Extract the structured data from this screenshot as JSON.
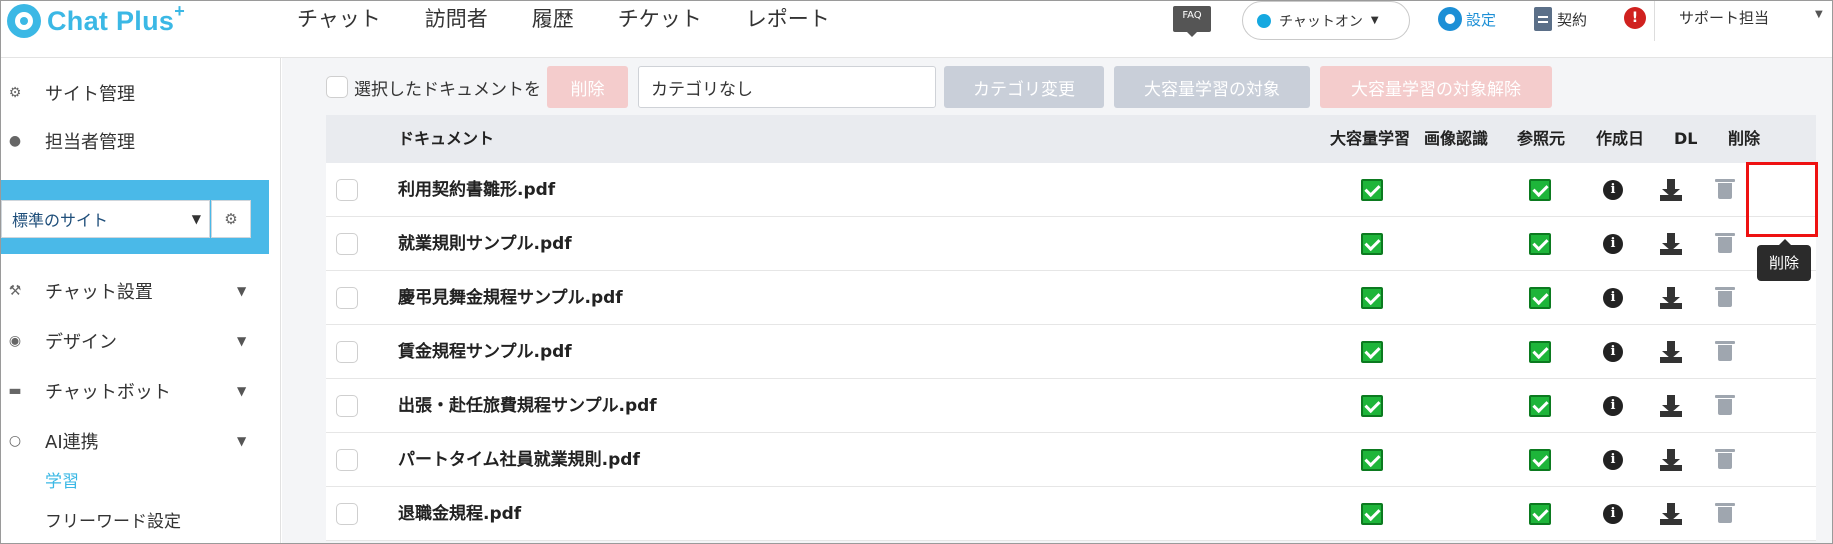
{
  "brand": {
    "name": "Chat Plus",
    "plus": "+"
  },
  "nav": {
    "menu": [
      "チャット",
      "訪問者",
      "履歴",
      "チケット",
      "レポート"
    ],
    "faq": "FAQ",
    "status": "チャットオン",
    "settings": "設定",
    "contract": "契約",
    "alert": "!",
    "user": "サポート担当"
  },
  "sidebar": {
    "site_management": "サイト管理",
    "staff_management": "担当者管理",
    "site_select": "標準のサイト",
    "chat_setup": "チャット設置",
    "design": "デザイン",
    "chatbot": "チャットボット",
    "ai": "AI連携",
    "learning": "学習",
    "freeword": "フリーワード設定"
  },
  "toolbar": {
    "selected_docs": "選択したドキュメントを",
    "delete": "削除",
    "category": "カテゴリなし",
    "change_category": "カテゴリ変更",
    "bulk_target": "大容量学習の対象",
    "bulk_remove": "大容量学習の対象解除"
  },
  "table": {
    "headers": {
      "document": "ドキュメント",
      "bulk": "大容量学習",
      "image": "画像認識",
      "reference": "参照元",
      "created": "作成日",
      "dl": "DL",
      "delete": "削除"
    },
    "rows": [
      {
        "name": "利用契約書雛形.pdf"
      },
      {
        "name": "就業規則サンプル.pdf"
      },
      {
        "name": "慶弔見舞金規程サンプル.pdf"
      },
      {
        "name": "賃金規程サンプル.pdf"
      },
      {
        "name": "出張・赴任旅費規程サンプル.pdf"
      },
      {
        "name": "パートタイム社員就業規則.pdf"
      },
      {
        "name": "退職金規程.pdf"
      }
    ]
  },
  "tooltip": "削除",
  "colors": {
    "brand": "#3bb8e5",
    "check": "#1eb53a",
    "highlight": "#e11111"
  }
}
